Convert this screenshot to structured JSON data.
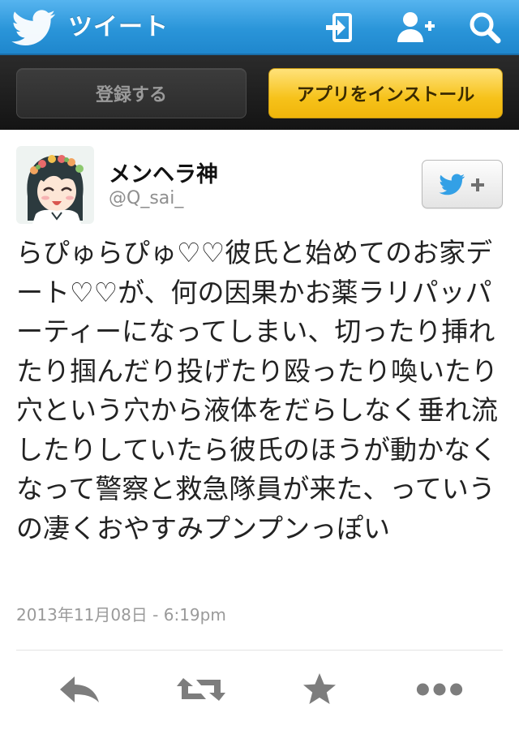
{
  "colors": {
    "topbar": "#2a95d9",
    "strip": "#1c1c1c",
    "install_button": "#f6c21a",
    "twitter_blue": "#33a0e6",
    "action_icon": "#7d7d7d"
  },
  "topbar": {
    "title": "ツイート",
    "icons": [
      "twitter-bird-icon",
      "sign-in-icon",
      "add-user-icon",
      "search-icon"
    ]
  },
  "actions": {
    "register_label": "登録する",
    "install_label": "アプリをインストール"
  },
  "tweet": {
    "author_name": "メンヘラ神",
    "author_handle": "@Q_sai_",
    "text": "らぴゅらぴゅ♡♡彼氏と始めてのお家デート♡♡が、何の因果かお薬ラリパッパーティーになってしまい、切ったり挿れたり掴んだり投げたり殴ったり喚いたり穴という穴から液体をだらしなく垂れ流したりしていたら彼氏のほうが動かなくなって警察と救急隊員が来た、っていうの凄くおやすみプンプンっぽい",
    "timestamp": "2013年11月08日 - 6:19pm"
  },
  "tweet_actions": {
    "icons": [
      "reply-icon",
      "retweet-icon",
      "favorite-star-icon",
      "more-dots-icon"
    ]
  }
}
